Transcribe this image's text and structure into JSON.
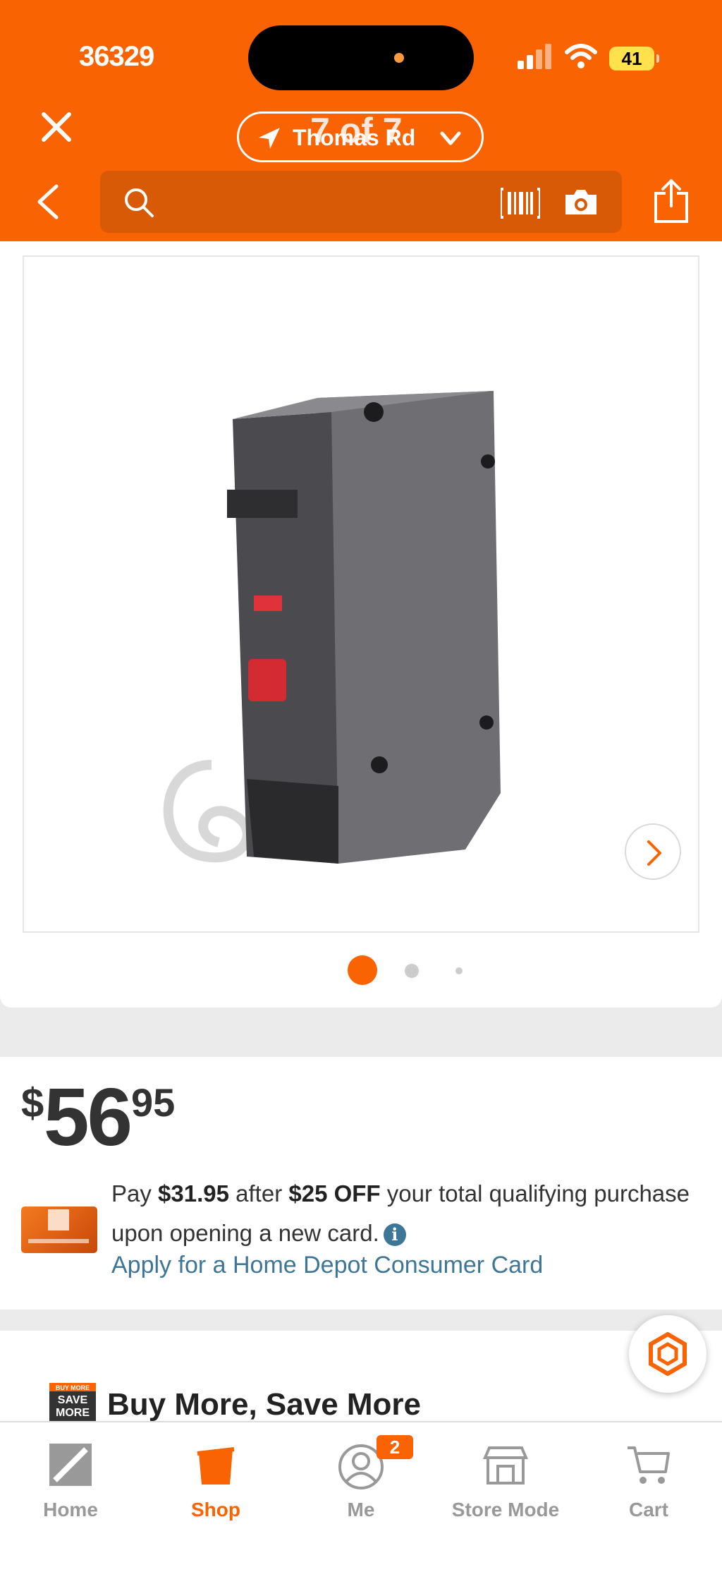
{
  "status_bar": {
    "time": "36329",
    "battery": "41"
  },
  "header": {
    "location": "Thomas Rd",
    "image_counter": "7 of 7",
    "search_placeholder": ""
  },
  "gallery": {
    "current_slide": 1,
    "total_dots": 3
  },
  "price": {
    "currency": "$",
    "dollars": "56",
    "cents": "95"
  },
  "promo": {
    "prefix": "Pay ",
    "pay_amount": "$31.95",
    "middle": " after ",
    "discount": "$25 OFF",
    "suffix": " your total qualifying purchase upon opening a new card.",
    "info_symbol": "i",
    "apply_link": "Apply for a Home Depot Consumer Card"
  },
  "bmsm": {
    "title": "Buy More, Save More",
    "icon_text": "BUY MORE SAVE MORE"
  },
  "tabbar": {
    "items": [
      {
        "label": "Home"
      },
      {
        "label": "Shop"
      },
      {
        "label": "Me"
      },
      {
        "label": "Store Mode"
      },
      {
        "label": "Cart"
      }
    ],
    "active": "Shop",
    "me_badge": "2"
  },
  "colors": {
    "brand_orange": "#f96302",
    "link_blue": "#3e7697",
    "search_bg": "#d85a07"
  }
}
